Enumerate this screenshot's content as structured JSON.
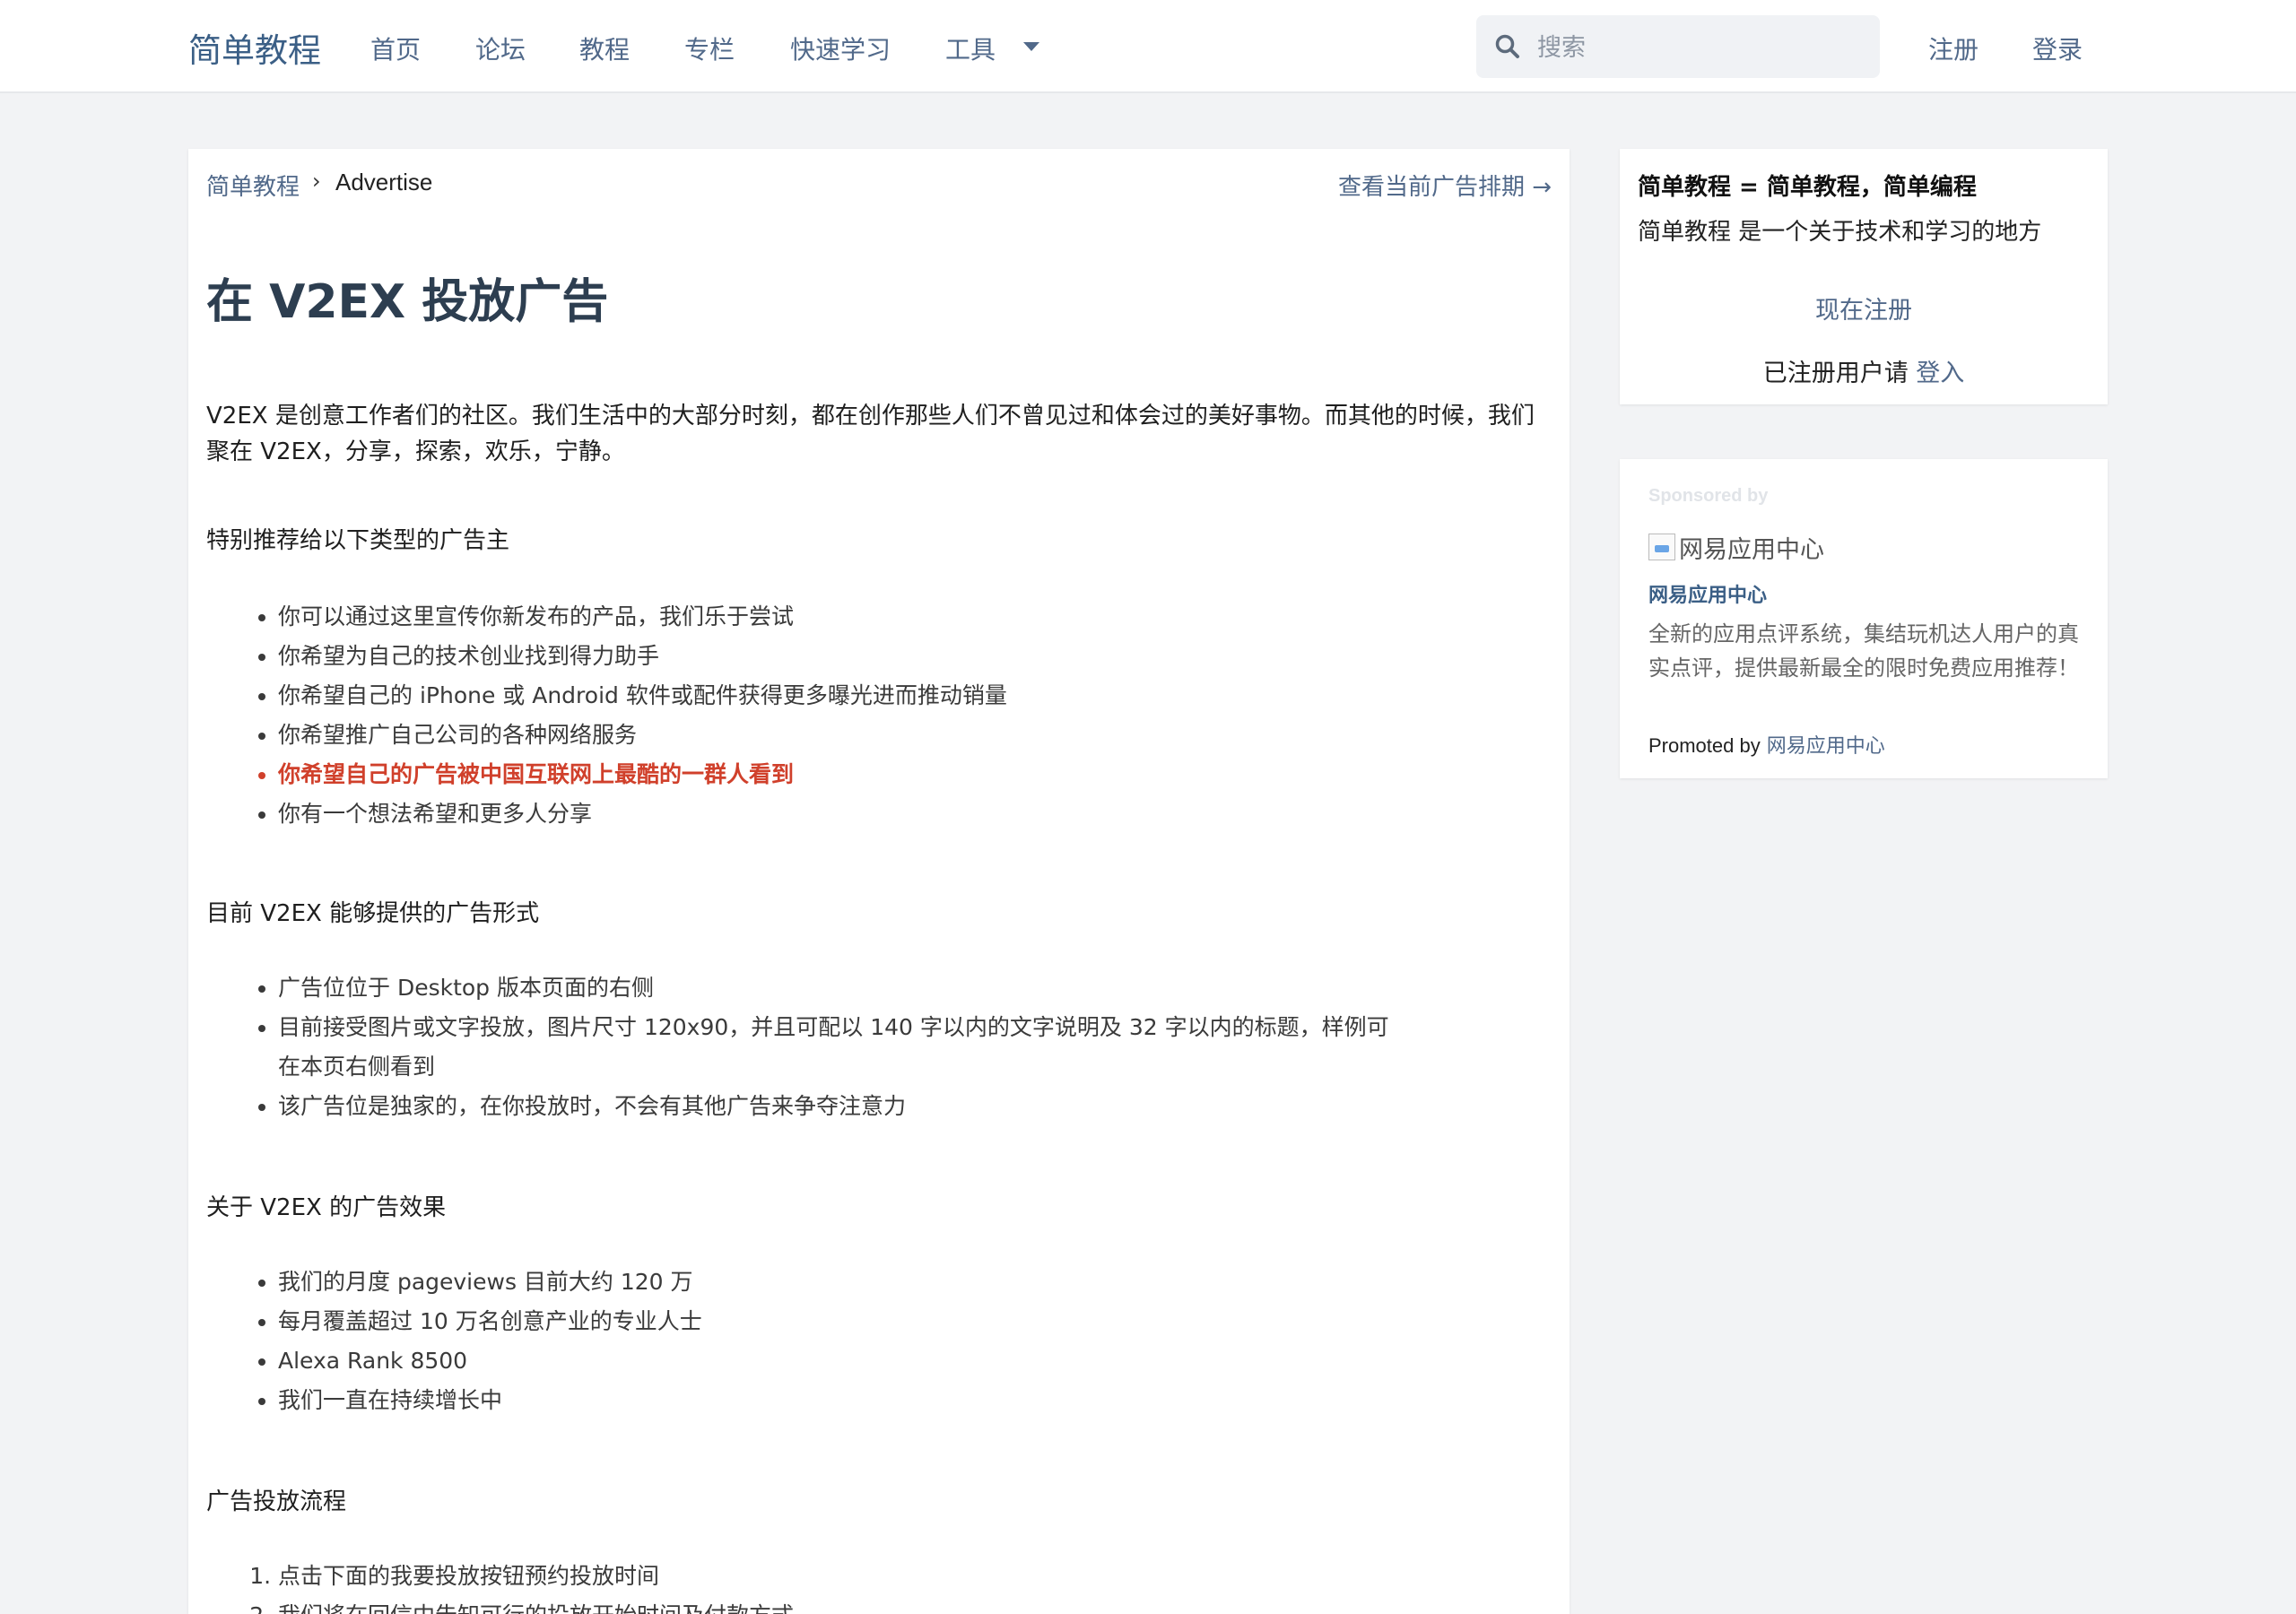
{
  "nav": {
    "brand": "简单教程",
    "items": [
      "首页",
      "论坛",
      "教程",
      "专栏",
      "快速学习",
      "工具"
    ],
    "search_placeholder": "搜索",
    "register": "注册",
    "login": "登录",
    "icons": {
      "search": "search-icon",
      "dropdown": "caret-down-icon"
    }
  },
  "breadcrumb": {
    "home": "简单教程",
    "separator": "›",
    "current": "Advertise",
    "right_link": "查看当前广告排期 →"
  },
  "article": {
    "title": "在 V2EX 投放广告",
    "intro": "V2EX 是创意工作者们的社区。我们生活中的大部分时刻，都在创作那些人们不曾见过和体会过的美好事物。而其他的时候，我们聚在 V2EX，分享，探索，欢乐，宁静。",
    "sections": [
      {
        "title": "特别推荐给以下类型的广告主",
        "items": [
          "你可以通过这里宣传你新发布的产品，我们乐于尝试",
          "你希望为自己的技术创业找到得力助手",
          "你希望自己的 iPhone 或 Android 软件或配件获得更多曝光进而推动销量",
          "你希望推广自己公司的各种网络服务",
          "你希望自己的广告被中国互联网上最酷的一群人看到",
          "你有一个想法希望和更多人分享"
        ]
      },
      {
        "title": "目前 V2EX 能够提供的广告形式",
        "items": [
          "广告位位于 Desktop 版本页面的右侧",
          "目前接受图片或文字投放，图片尺寸 120x90，并且可配以 140 字以内的文字说明及 32 字以内的标题，样例可在本页右侧看到",
          "该广告位是独家的，在你投放时，不会有其他广告来争夺注意力"
        ]
      },
      {
        "title": "关于 V2EX 的广告效果",
        "items": [
          "我们的月度 pageviews 目前大约 120 万",
          "每月覆盖超过 10 万名创意产业的专业人士",
          "Alexa Rank 8500",
          "我们一直在持续增长中"
        ]
      },
      {
        "title": "广告投放流程",
        "items": [
          "点击下面的我要投放按钮预约投放时间",
          "我们将在回信中告知可行的投放开始时间及付款方式"
        ]
      }
    ],
    "highlight_color": "#d0402b"
  },
  "sidebar": {
    "site_title": "简单教程 = 简单教程，简单编程",
    "site_desc": "简单教程 是一个关于技术和学习的地方",
    "register_now": "现在注册",
    "login_prompt": "已注册用户请",
    "login_link": "登入",
    "sponsor": {
      "label": "Sponsored by",
      "image_alt": "网易应用中心",
      "name": "网易应用中心",
      "desc": "全新的应用点评系统，集结玩机达人用户的真实点评，提供最新最全的限时免费应用推荐！",
      "promoted_by": "Promoted by",
      "promoted_link": "网易应用中心"
    }
  }
}
